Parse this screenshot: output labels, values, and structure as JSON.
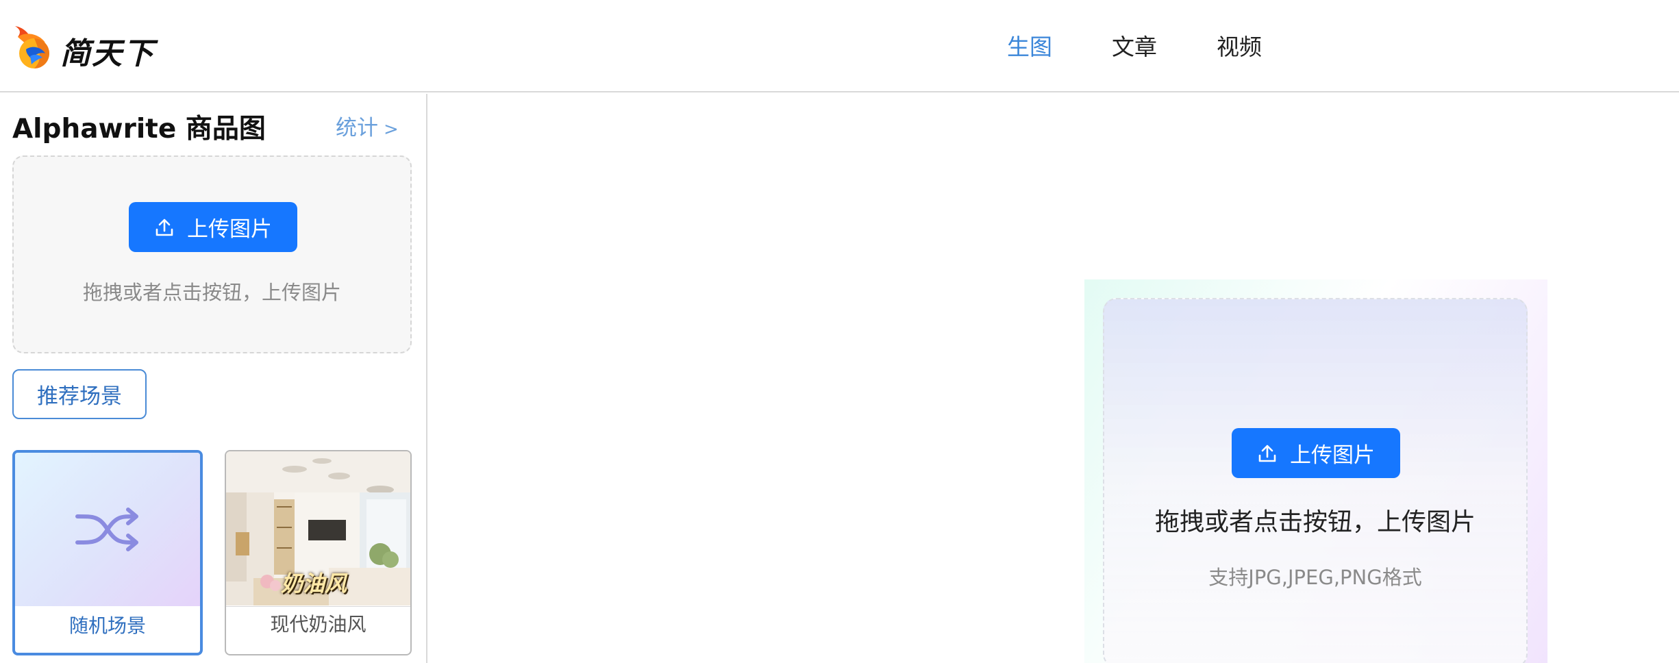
{
  "brand": {
    "name": "简天下",
    "logo_icon": "flame-bird-logo-icon"
  },
  "nav": {
    "items": [
      {
        "label": "生图",
        "active": true
      },
      {
        "label": "文章",
        "active": false
      },
      {
        "label": "视频",
        "active": false
      }
    ],
    "active_color": "#3b86d9"
  },
  "sidebar": {
    "title": "Alphawrite 商品图",
    "stats_link": "统计",
    "stats_chevron": ">",
    "upload": {
      "button_label": "上传图片",
      "icon": "upload-icon",
      "hint": "拖拽或者点击按钮，上传图片"
    },
    "scene_button": "推荐场景",
    "scenes": [
      {
        "label": "随机场景",
        "icon": "shuffle-icon",
        "selected": true
      },
      {
        "label": "现代奶油风",
        "caption": "奶油风",
        "selected": false
      }
    ]
  },
  "main": {
    "dropzone": {
      "button_label": "上传图片",
      "icon": "upload-icon",
      "title": "拖拽或者点击按钮，上传图片",
      "subtitle": "支持JPG,JPEG,PNG格式"
    }
  },
  "colors": {
    "primary": "#1677ff",
    "link": "#6aa0dc",
    "selected_border": "#4a8be0"
  }
}
